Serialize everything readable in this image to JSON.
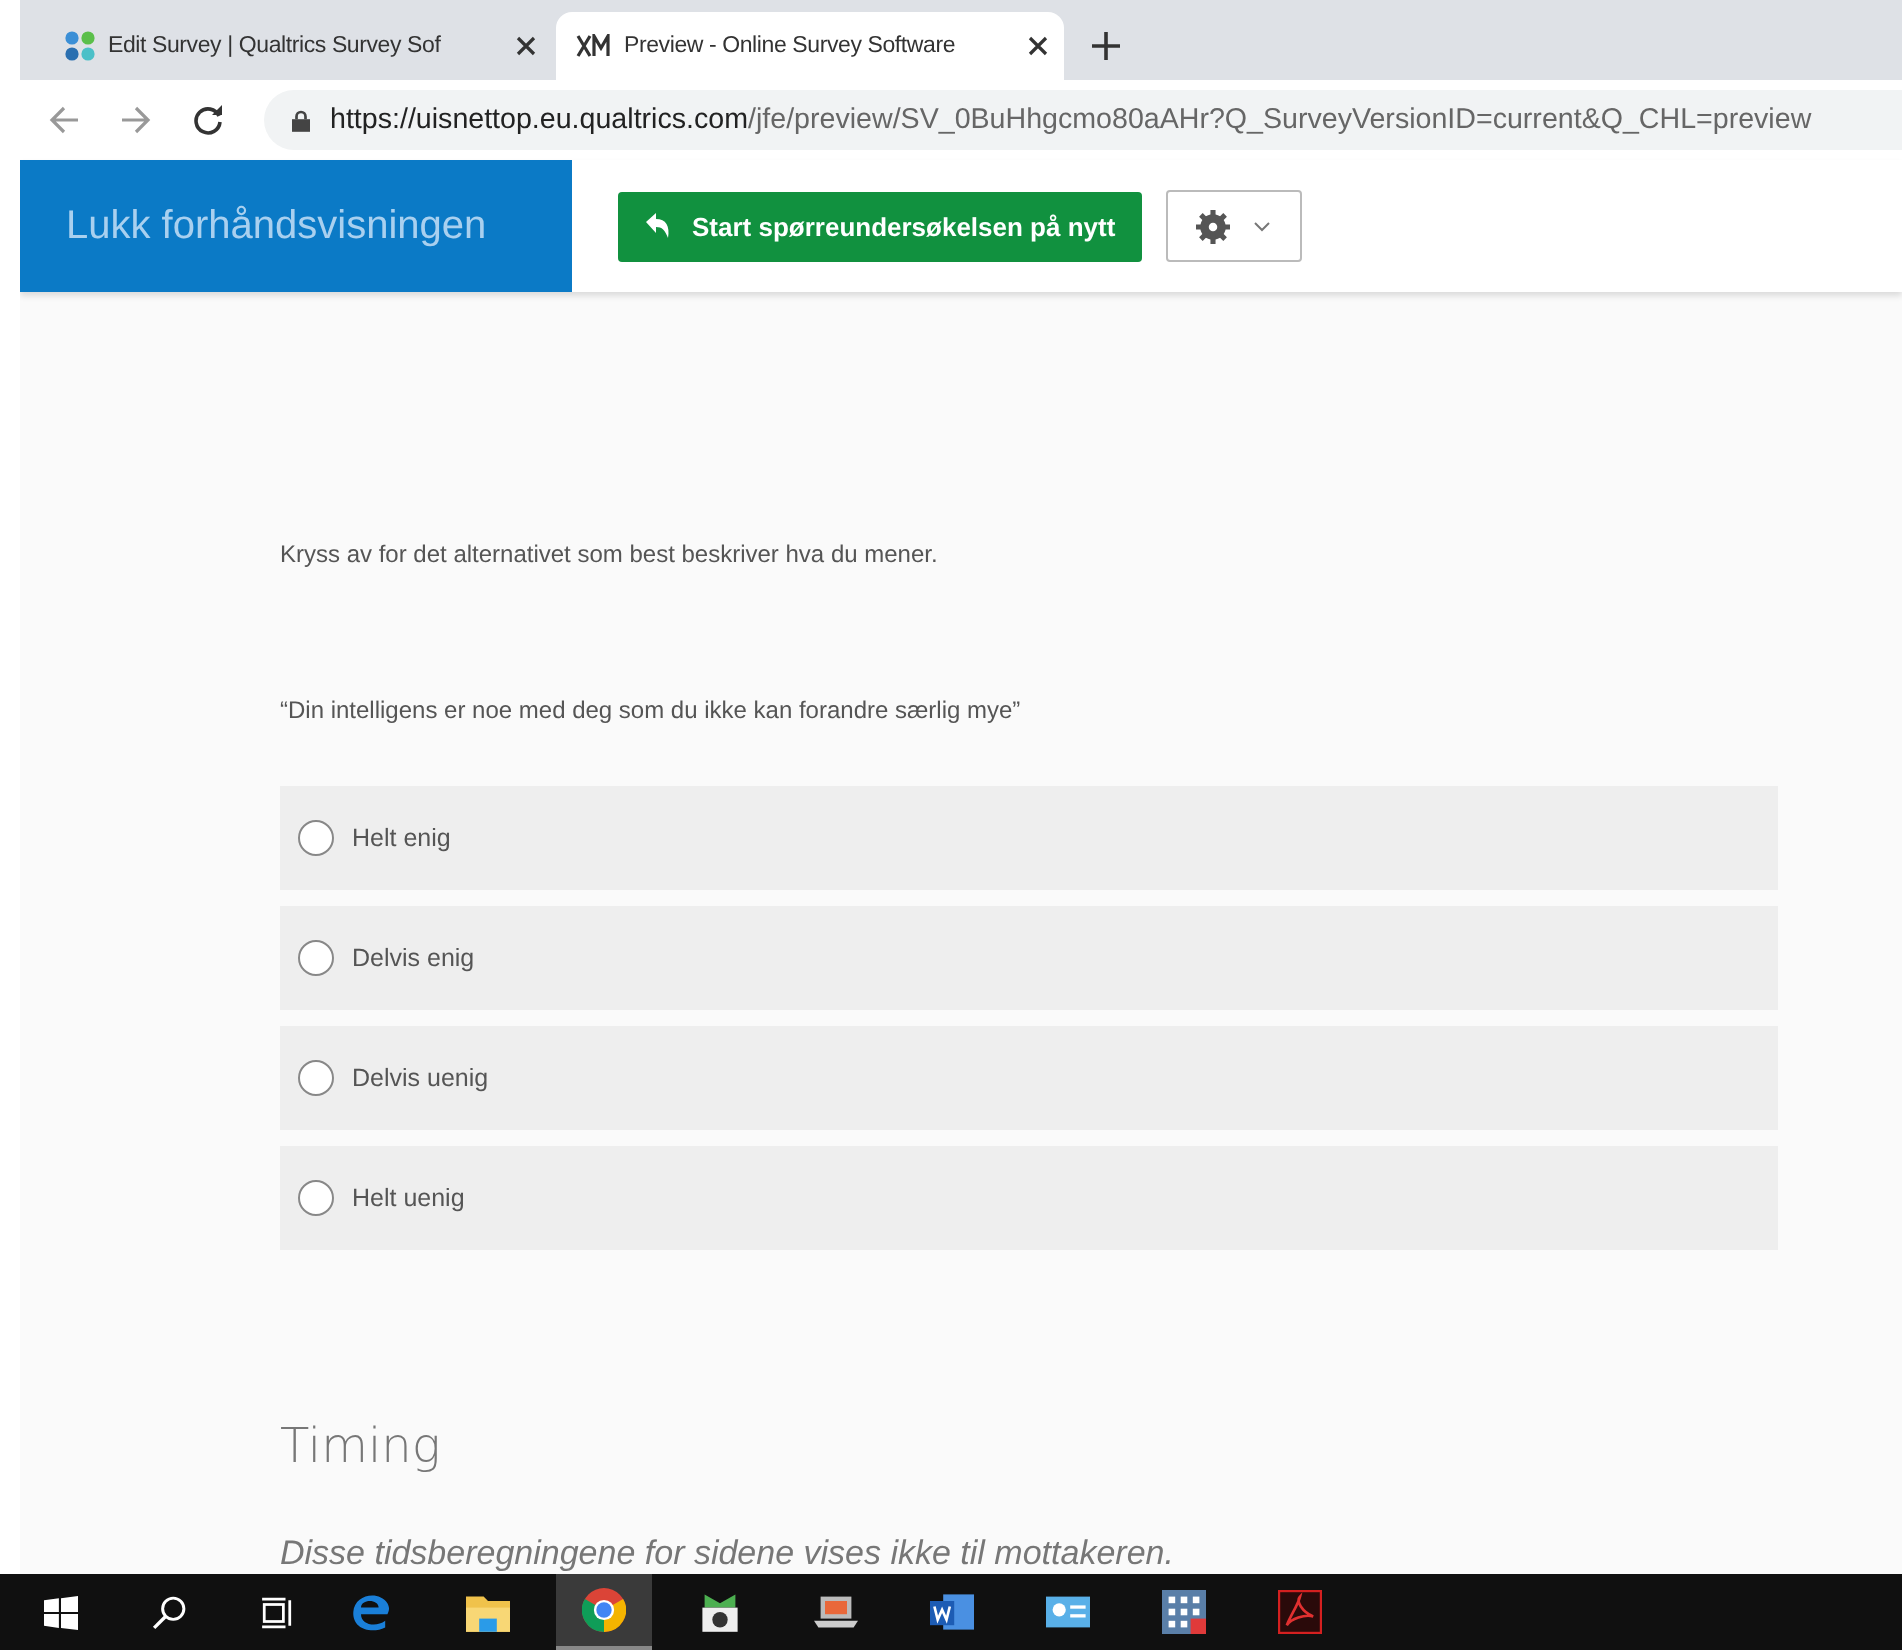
{
  "browser": {
    "tabs": [
      {
        "title": "Edit Survey | Qualtrics Survey Sof",
        "selected": false
      },
      {
        "title": "Preview - Online Survey Software",
        "selected": true
      }
    ],
    "url": {
      "host": "https://uisnettop.eu.qualtrics.com",
      "path": "/jfe/preview/SV_0BuHhgcmo80aAHr?Q_SurveyVersionID=current&Q_CHL=preview"
    }
  },
  "preview_bar": {
    "close_label": "Lukk forhåndsvisningen",
    "restart_button": "Start spørreundersøkelsen på nytt"
  },
  "question": {
    "instruction": "Kryss av for det alternativet som best beskriver hva du mener.",
    "statement": "“Din intelligens er noe med deg som du ikke kan forandre særlig mye”",
    "options": [
      {
        "label": "Helt enig",
        "selected": false
      },
      {
        "label": "Delvis enig",
        "selected": false
      },
      {
        "label": "Delvis uenig",
        "selected": false
      },
      {
        "label": "Helt uenig",
        "selected": false
      }
    ]
  },
  "timing": {
    "title": "Timing",
    "note": "Disse tidsberegningene for sidene vises ikke til mottakeren."
  },
  "taskbar_apps": [
    {
      "selected": false
    },
    {
      "selected": false
    },
    {
      "selected": true
    },
    {
      "selected": false
    },
    {
      "selected": false
    },
    {
      "selected": false
    },
    {
      "selected": false
    },
    {
      "selected": false
    },
    {
      "selected": false
    }
  ]
}
